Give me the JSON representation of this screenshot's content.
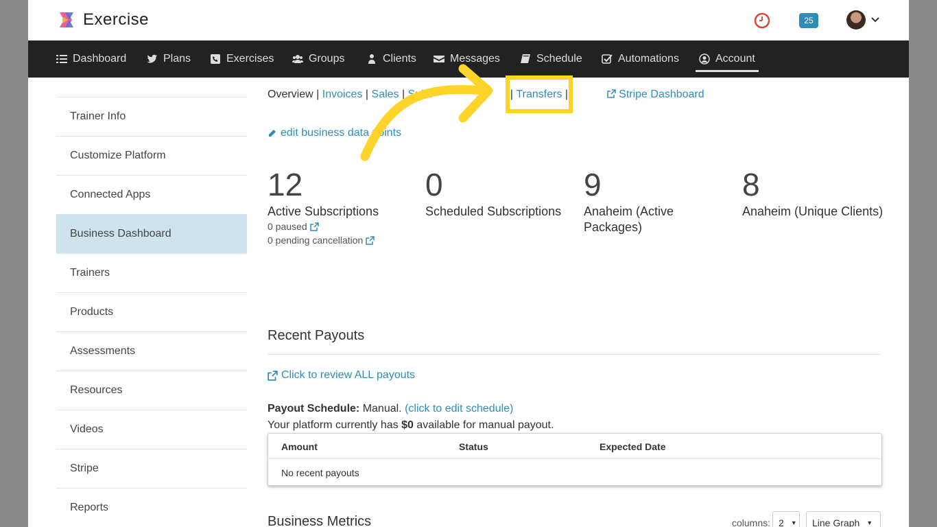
{
  "app": {
    "name": "Exercise"
  },
  "header": {
    "calendar_badge": "25"
  },
  "nav": [
    {
      "label": "Dashboard",
      "icon": "list-icon"
    },
    {
      "label": "Plans",
      "icon": "twitter-icon"
    },
    {
      "label": "Exercises",
      "icon": "phone-icon"
    },
    {
      "label": "Groups",
      "icon": "users-icon"
    },
    {
      "label": "Clients",
      "icon": "user-icon"
    },
    {
      "label": "Messages",
      "icon": "envelope-icon"
    },
    {
      "label": "Schedule",
      "icon": "book-icon"
    },
    {
      "label": "Automations",
      "icon": "check-square-icon"
    },
    {
      "label": "Account",
      "icon": "user-circle-icon"
    }
  ],
  "sidebar": {
    "items": [
      "Trainer Info",
      "Customize Platform",
      "Connected Apps",
      "Business Dashboard",
      "Trainers",
      "Products",
      "Assessments",
      "Resources",
      "Videos",
      "Stripe",
      "Reports"
    ],
    "active": "Business Dashboard"
  },
  "subnav": {
    "overview": "Overview",
    "invoices": "Invoices",
    "sales": "Sales",
    "subscriptions_partial": "Subs",
    "charges_partial": "ges",
    "transfers": "Transfers",
    "stripe_dashboard": "Stripe Dashboard"
  },
  "edit_link": "edit business data points",
  "stats": [
    {
      "number": "12",
      "label": "Active Subscriptions",
      "sub": [
        "0 paused",
        "0 pending cancellation"
      ]
    },
    {
      "number": "0",
      "label": "Scheduled Subscriptions",
      "sub": []
    },
    {
      "number": "9",
      "label": "Anaheim (Active Packages)",
      "sub": []
    },
    {
      "number": "8",
      "label": "Anaheim (Unique Clients)",
      "sub": []
    }
  ],
  "payouts": {
    "title": "Recent Payouts",
    "review_link": "Click to review ALL payouts",
    "schedule_label": "Payout Schedule:",
    "schedule_value": "Manual.",
    "schedule_edit": "(click to edit schedule)",
    "available_prefix": "Your platform currently has",
    "available_amount": "$0",
    "available_suffix": "available for manual payout.",
    "columns": [
      "Amount",
      "Status",
      "Expected Date"
    ],
    "empty": "No recent payouts"
  },
  "metrics": {
    "title": "Business Metrics",
    "columns_label": "columns:",
    "columns_value": "2",
    "graph_type": "Line Graph"
  },
  "colors": {
    "accent": "#2e8db8",
    "highlight": "#ffd42a",
    "nav_bg": "#222222",
    "active_bg": "#cfe3ec"
  }
}
